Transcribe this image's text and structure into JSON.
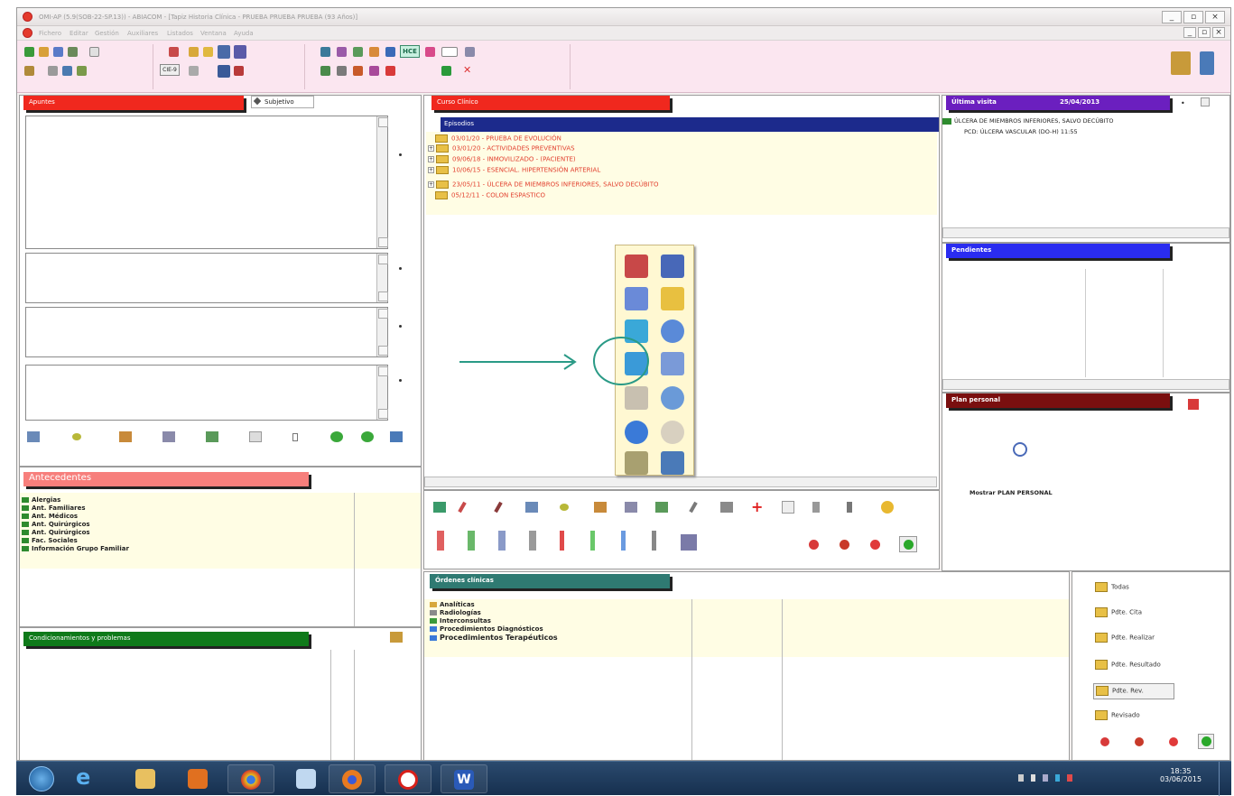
{
  "window": {
    "title": "OMI-AP (5.9(SOB-22-SP.13)) - ABIACOM - [Tapiz Historia Clínica - PRUEBA PRUEBA PRUEBA (93 Años)]",
    "controls": [
      "_",
      "▫",
      "×"
    ],
    "mdi_controls": [
      "_",
      "▫",
      "×"
    ]
  },
  "menu": [
    "Fichero",
    "Editar",
    "Gestión",
    "Auxiliares",
    "Listados",
    "Ventana",
    "Ayuda"
  ],
  "toolbar": {
    "hce_label": "HCE",
    "cie_label": "CIE-9"
  },
  "apuntes": {
    "tab_label": "Apuntes",
    "subtab_label": "Subjetivo"
  },
  "antecedentes": {
    "tab_label": "Antecedentes",
    "items": [
      "Alergias",
      "Ant. Familiares",
      "Ant. Médicos",
      "Ant. Quirúrgicos",
      "Ant. Quirúrgicos",
      "Fac. Sociales",
      "Información Grupo Familiar"
    ]
  },
  "condicionamientos": {
    "tab_label": "Condicionamientos y problemas"
  },
  "curso_clinico": {
    "tab_label": "Curso Clínico",
    "header": "Episodios",
    "episodes": [
      "03/01/20 - PRUEBA DE EVOLUCIÓN",
      "03/01/20 - ACTIVIDADES PREVENTIVAS",
      "09/06/18 - INMOVILIZADO - (PACIENTE)",
      "10/06/15 - ESENCIAL. HIPERTENSIÓN ARTERIAL",
      "23/05/11 - ÚLCERA DE MIEMBROS INFERIORES, SALVO DECÚBITO",
      "05/12/11 - COLON ESPASTICO"
    ]
  },
  "ultima_visita": {
    "tab_label": "Última visita",
    "date": "25/04/2013",
    "lines": [
      "ÚLCERA DE MIEMBROS INFERIORES, SALVO DECÚBITO",
      "PCD: ÚLCERA VASCULAR (DO-H) 11:55"
    ]
  },
  "pendientes": {
    "tab_label": "Pendientes"
  },
  "plan_personal": {
    "tab_label": "Plan personal",
    "link_label": "Mostrar PLAN PERSONAL"
  },
  "ordenes": {
    "tab_label": "Órdenes clínicas",
    "items": [
      "Analíticas",
      "Radiologías",
      "Interconsultas",
      "Procedimientos Diagnósticos",
      "Procedimientos Terapéuticos"
    ]
  },
  "filters": [
    "Todas",
    "Pdte. Cita",
    "Pdte. Realizar",
    "Pdte. Resultado",
    "Pdte. Rev.",
    "Revisado"
  ],
  "taskbar": {
    "time": "18:35",
    "date": "03/06/2015"
  },
  "colors": {
    "toolbar_bg": "#fbe6f0",
    "red_tab": "#f0281e",
    "navy_header": "#1c2a8c",
    "purple_tab": "#6b1fbf",
    "blue_tab": "#2a2cf0",
    "maroon_tab": "#7a0f0f",
    "salmon_tab": "#f77f7c",
    "green_tab": "#0f7a1a",
    "teal_tab": "#2f7a72",
    "arrow": "#2a9a86"
  }
}
